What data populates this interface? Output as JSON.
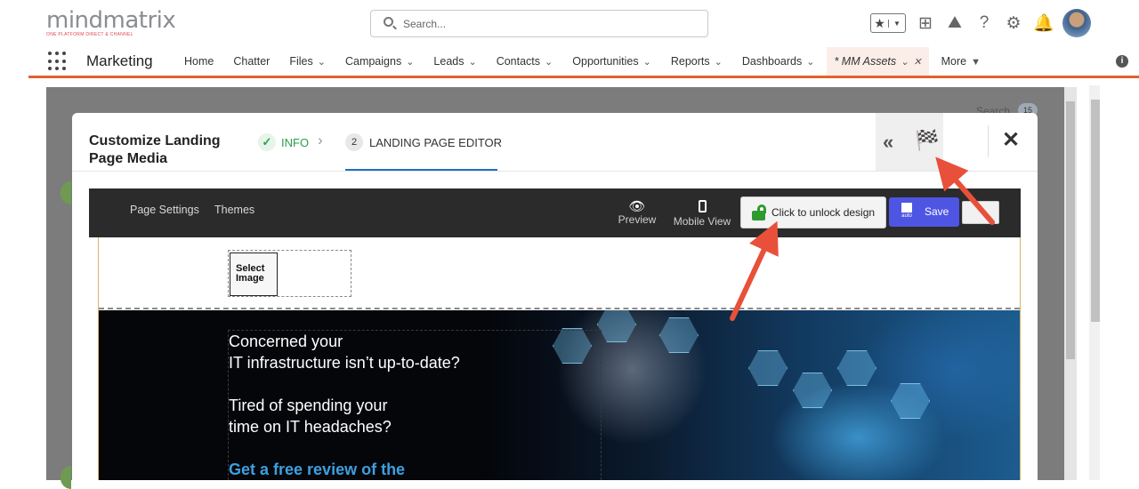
{
  "header": {
    "logo_text": "mindmatrix",
    "logo_tagline": "ONE PLATFORM DIRECT & CHANNEL",
    "search_placeholder": "Search..."
  },
  "nav": {
    "app_name": "Marketing",
    "items": [
      {
        "label": "Home",
        "dropdown": false
      },
      {
        "label": "Chatter",
        "dropdown": false
      },
      {
        "label": "Files",
        "dropdown": true
      },
      {
        "label": "Campaigns",
        "dropdown": true
      },
      {
        "label": "Leads",
        "dropdown": true
      },
      {
        "label": "Contacts",
        "dropdown": true
      },
      {
        "label": "Opportunities",
        "dropdown": true
      },
      {
        "label": "Reports",
        "dropdown": true
      },
      {
        "label": "Dashboards",
        "dropdown": true
      }
    ],
    "active_tab": "* MM Assets",
    "more_label": "More"
  },
  "background": {
    "search_label": "Search",
    "badge": "15"
  },
  "modal": {
    "title": "Customize Landing Page Media",
    "step1_label": "INFO",
    "step2_number": "2",
    "step2_label": "LANDING PAGE EDITOR"
  },
  "editor_toolbar": {
    "page_settings": "Page Settings",
    "themes": "Themes",
    "preview": "Preview",
    "mobile_view": "Mobile View",
    "unlock_label": "Click to unlock design",
    "save_auto": "auto",
    "save_label": "Save"
  },
  "canvas": {
    "select_image": "Select Image",
    "hero_line1": "Concerned your",
    "hero_line2": "IT infrastructure isn’t up-to-date?",
    "hero_line3": "Tired of spending your",
    "hero_line4": "time on IT headaches?",
    "hero_cta": "Get a free review of the"
  },
  "colors": {
    "accent_nav": "#e2612e",
    "step_done": "#2e9e4f",
    "step_active_underline": "#1f6fc5",
    "save_button": "#4f55e3",
    "unlock_icon": "#2f9a2f",
    "annotation_arrow": "#e8503a",
    "cta_text": "#3da0e0"
  }
}
